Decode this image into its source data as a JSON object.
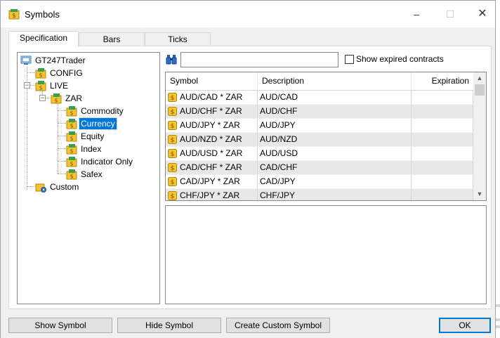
{
  "window": {
    "title": "Symbols",
    "icon": "symbols-app-icon"
  },
  "title_controls": {
    "minimize": "–",
    "maximize": "☐",
    "close": "✕"
  },
  "tabs": [
    {
      "label": "Specification",
      "active": true
    },
    {
      "label": "Bars",
      "active": false
    },
    {
      "label": "Ticks",
      "active": false
    }
  ],
  "tree": {
    "root": "GT247Trader",
    "config": "CONFIG",
    "live": "LIVE",
    "zar": "ZAR",
    "children": [
      "Commodity",
      "Currency",
      "Equity",
      "Index",
      "Indicator Only",
      "Safex"
    ],
    "selected": "Currency",
    "custom": "Custom"
  },
  "search": {
    "value": "",
    "placeholder": ""
  },
  "show_expired": {
    "label": "Show expired contracts",
    "checked": false
  },
  "table": {
    "columns": [
      "Symbol",
      "Description",
      "Expiration"
    ],
    "rows": [
      {
        "symbol": "AUD/CAD * ZAR",
        "description": "AUD/CAD",
        "expiration": ""
      },
      {
        "symbol": "AUD/CHF * ZAR",
        "description": "AUD/CHF",
        "expiration": ""
      },
      {
        "symbol": "AUD/JPY * ZAR",
        "description": "AUD/JPY",
        "expiration": ""
      },
      {
        "symbol": "AUD/NZD * ZAR",
        "description": "AUD/NZD",
        "expiration": ""
      },
      {
        "symbol": "AUD/USD * ZAR",
        "description": "AUD/USD",
        "expiration": ""
      },
      {
        "symbol": "CAD/CHF * ZAR",
        "description": "CAD/CHF",
        "expiration": ""
      },
      {
        "symbol": "CAD/JPY * ZAR",
        "description": "CAD/JPY",
        "expiration": ""
      },
      {
        "symbol": "CHF/JPY * ZAR",
        "description": "CHF/JPY",
        "expiration": ""
      }
    ]
  },
  "buttons": {
    "show_symbol": "Show Symbol",
    "hide_symbol": "Hide Symbol",
    "create_custom": "Create Custom Symbol",
    "ok": "OK"
  },
  "colors": {
    "selection": "#0078d7",
    "folder_yellow": "#f4c233",
    "icon_green": "#3aa04a",
    "row_alt": "#e8e8e8"
  }
}
